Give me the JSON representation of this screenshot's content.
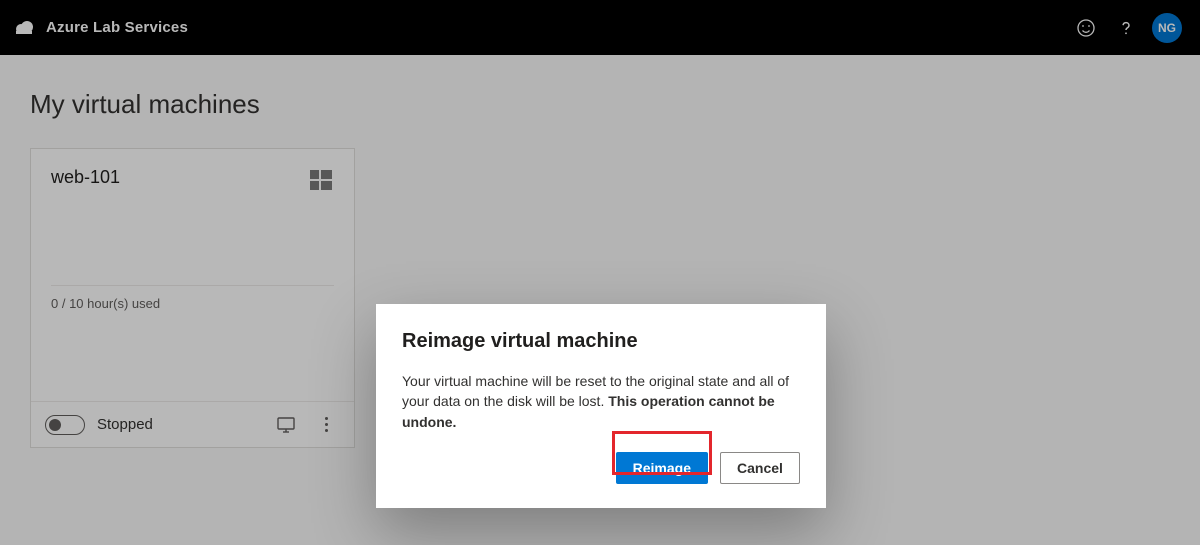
{
  "header": {
    "product_name": "Azure Lab Services",
    "avatar_initials": "NG"
  },
  "page": {
    "title": "My virtual machines"
  },
  "vm": {
    "name": "web-101",
    "hours_used_text": "0 / 10 hour(s) used",
    "status": "Stopped",
    "os_icon": "windows-icon"
  },
  "dialog": {
    "title": "Reimage virtual machine",
    "body_plain": "Your virtual machine will be reset to the original state and all of your data on the disk will be lost. ",
    "body_bold": "This operation cannot be undone.",
    "confirm_label": "Reimage",
    "cancel_label": "Cancel"
  }
}
